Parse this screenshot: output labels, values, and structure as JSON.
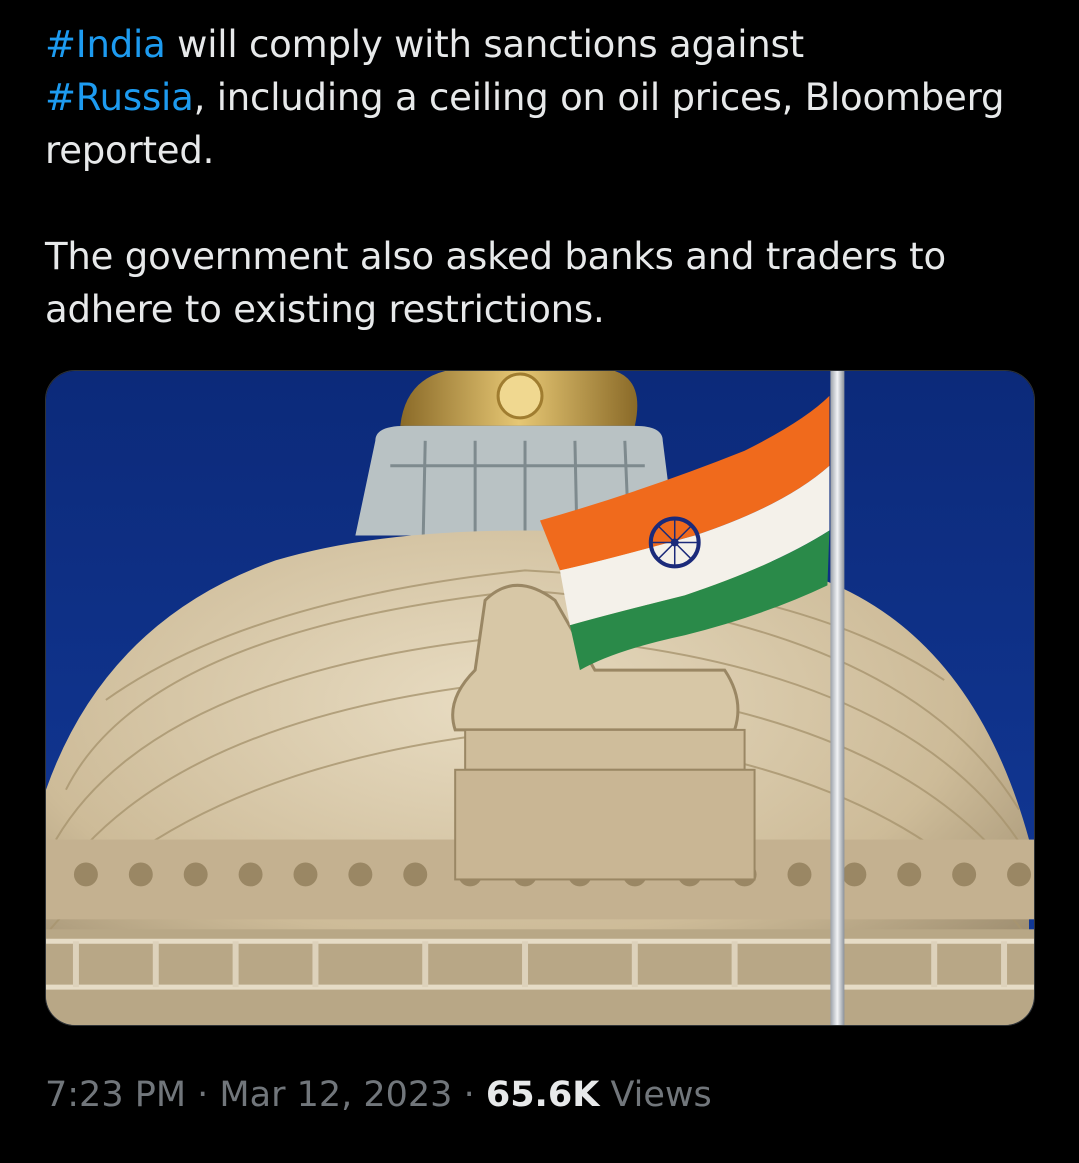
{
  "tweet": {
    "hashtag_india": "#India",
    "line1_rest": " will comply with sanctions against",
    "hashtag_russia": "#Russia",
    "line2_rest": ", including a ceiling on oil prices, Bloomberg reported.",
    "paragraph2": "The government also asked banks and traders to adhere to existing restrictions."
  },
  "media": {
    "description_icon": "photo-icon"
  },
  "meta": {
    "time": "7:23 PM",
    "separator1": " · ",
    "date": "Mar 12, 2023",
    "separator2": " · ",
    "views_count": "65.6K",
    "views_label": " Views"
  },
  "colors": {
    "background": "#000000",
    "text": "#e7e9ea",
    "link": "#1d9bf0",
    "secondary": "#71767b"
  }
}
